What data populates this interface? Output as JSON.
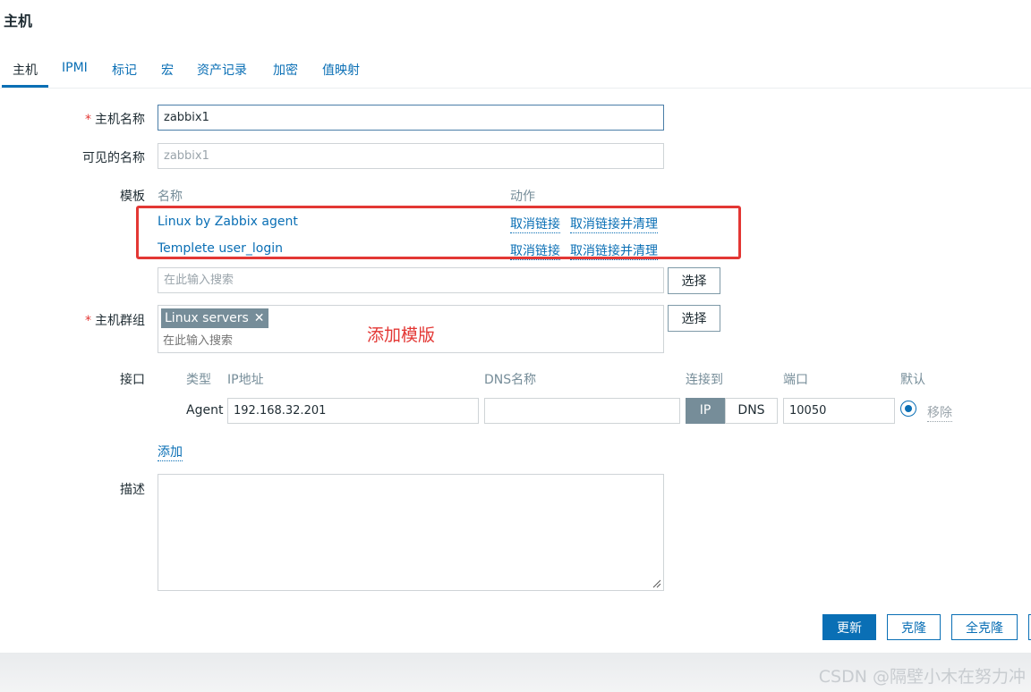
{
  "page": {
    "title": "主机"
  },
  "tabs": [
    {
      "label": "主机"
    },
    {
      "label": "IPMI"
    },
    {
      "label": "标记"
    },
    {
      "label": "宏"
    },
    {
      "label": "资产记录"
    },
    {
      "label": "加密"
    },
    {
      "label": "值映射"
    }
  ],
  "form": {
    "host_name": {
      "label": "主机名称",
      "value": "zabbix1"
    },
    "visible_name": {
      "label": "可见的名称",
      "placeholder": "zabbix1"
    },
    "templates": {
      "label": "模板",
      "col_name": "名称",
      "col_action": "动作",
      "rows": [
        {
          "name": "Linux by Zabbix agent",
          "unlink": "取消链接",
          "unlink_clear": "取消链接并清理"
        },
        {
          "name": "Templete user_login",
          "unlink": "取消链接",
          "unlink_clear": "取消链接并清理"
        }
      ],
      "search_placeholder": "在此输入搜索",
      "select_label": "选择"
    },
    "host_groups": {
      "label": "主机群组",
      "tag": "Linux servers",
      "tag_remove": "✕",
      "search_placeholder": "在此输入搜索",
      "select_label": "选择"
    },
    "interfaces": {
      "label": "接口",
      "col_type": "类型",
      "col_ip": "IP地址",
      "col_dns": "DNS名称",
      "col_connect": "连接到",
      "col_port": "端口",
      "col_default": "默认",
      "row": {
        "type": "Agent",
        "ip": "192.168.32.201",
        "dns": "",
        "connect_ip": "IP",
        "connect_dns": "DNS",
        "port": "10050",
        "remove": "移除"
      },
      "add_label": "添加"
    },
    "description": {
      "label": "描述",
      "value": ""
    }
  },
  "annotation": {
    "text": "添加模版"
  },
  "actions": {
    "update": "更新",
    "clone": "克隆",
    "full_clone": "全克隆"
  },
  "watermark": "CSDN @隔壁小木在努力冲",
  "colors": {
    "accent": "#0a6fb5",
    "annotation": "#e33734"
  }
}
